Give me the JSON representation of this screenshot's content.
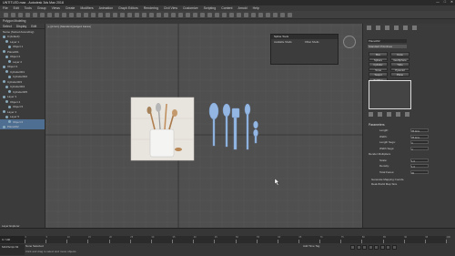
{
  "app": {
    "title": "UNTITLED.max - Autodesk 3ds Max 2018",
    "window_controls": [
      "—",
      "□",
      "✕"
    ]
  },
  "menu": [
    "File",
    "Edit",
    "Tools",
    "Group",
    "Views",
    "Create",
    "Modifiers",
    "Animation",
    "Graph Editors",
    "Rendering",
    "Civil View",
    "Customize",
    "Scripting",
    "Content",
    "Arnold",
    "Help"
  ],
  "ribbon": {
    "label": "Polygon Modeling"
  },
  "scene_explorer": {
    "tabs": [
      "Select",
      "Display",
      "Edit"
    ],
    "header": "Name (Sorted Ascending)",
    "items": [
      {
        "label": "0 (default)",
        "selected": false
      },
      {
        "label": "Layer 1",
        "selected": false
      },
      {
        "label": "Object 1",
        "selected": false
      },
      {
        "label": "Plane001",
        "selected": false
      },
      {
        "label": "Object 2",
        "selected": false
      },
      {
        "label": "Layer 2",
        "selected": false
      },
      {
        "label": "Object 3",
        "selected": false
      },
      {
        "label": "Cylinder001",
        "selected": false
      },
      {
        "label": "Cylinder002",
        "selected": false
      },
      {
        "label": "Cylinder003",
        "selected": false
      },
      {
        "label": "Cylinder004",
        "selected": false
      },
      {
        "label": "Cylinder005",
        "selected": false
      },
      {
        "label": "Layer 3",
        "selected": false
      },
      {
        "label": "Object 4",
        "selected": false
      },
      {
        "label": "Object 5",
        "selected": false
      },
      {
        "label": "Layer 4",
        "selected": false
      },
      {
        "label": "Layer 5",
        "selected": false
      },
      {
        "label": "Object 6",
        "selected": true
      },
      {
        "label": "Plane002",
        "selected": true
      }
    ],
    "footer": "Layer Explorer"
  },
  "viewport": {
    "label": "[+] [Front] [Standard] [Edged Faces]"
  },
  "float_dialog": {
    "title": "Spline Tools",
    "col1": "Available Shells",
    "col2": "Offset Shells"
  },
  "command_panel": {
    "object_name": "Plane002",
    "dropdown": "Standard Primitives",
    "object_type_header": "Object Type",
    "buttons": [
      "Box",
      "Cone",
      "Sphere",
      "GeoSphere",
      "Cylinder",
      "Tube",
      "Torus",
      "Pyramid",
      "Teapot",
      "Plane",
      "TextPlus"
    ],
    "name_color_header": "Name and Color",
    "params_header": "Parameters",
    "params": [
      {
        "label": "Length:",
        "value": "78.0cm"
      },
      {
        "label": "Width:",
        "value": "78.0cm"
      },
      {
        "label": "Length Segs:",
        "value": "4"
      },
      {
        "label": "Width Segs:",
        "value": "4"
      },
      {
        "label": "Render Multipliers",
        "value": ""
      },
      {
        "label": "Scale:",
        "value": "1.0"
      },
      {
        "label": "Density:",
        "value": "1.0"
      },
      {
        "label": "Total Faces:",
        "value": "32"
      }
    ],
    "checks": [
      "Generate Mapping Coords.",
      "Real-World Map Size"
    ]
  },
  "timeline": {
    "position": "0 / 100",
    "ticks": [
      "0",
      "5",
      "10",
      "15",
      "20",
      "25",
      "30",
      "35",
      "40",
      "45",
      "50",
      "55",
      "60",
      "65",
      "70",
      "75",
      "80",
      "85",
      "90",
      "95",
      "100"
    ]
  },
  "status": {
    "line1": "None Selected",
    "line2": "Click and drag to select and move objects",
    "tools": "Add Time Tag",
    "maxscript": "MAXScript Mi"
  },
  "colors": {
    "accent": "#4e6e92",
    "bg": "#4f4f4f",
    "utensil": "#93b7e2"
  }
}
